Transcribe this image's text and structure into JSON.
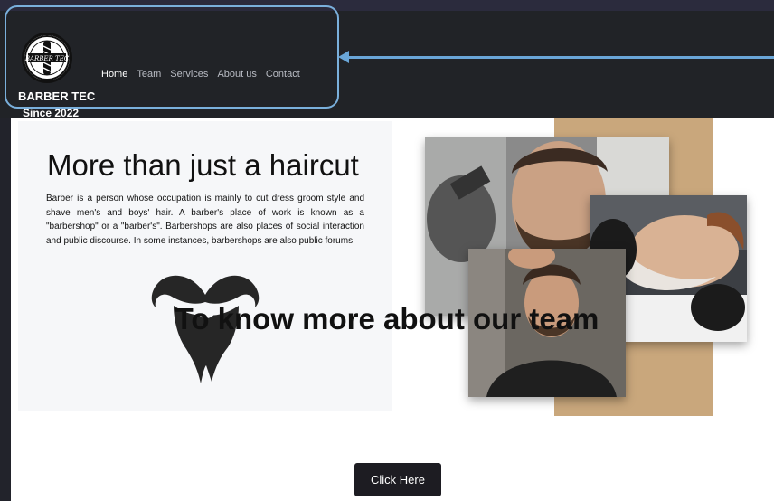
{
  "brand": {
    "logo_text": "BARBER TEC",
    "name": "BARBER TEC",
    "since": "Since 2022"
  },
  "nav": {
    "items": [
      "Home",
      "Team",
      "Services",
      "About us",
      "Contact"
    ],
    "active": "Home"
  },
  "hero": {
    "title": "More than just a haircut",
    "text": "Barber is a person whose occupation is mainly to cut dress groom style and shave men's and boys' hair. A barber's place of work is known as a \"barbershop\" or a \"barber's\". Barbershops are also places of social interaction and public discourse. In some instances, barbershops are also public forums",
    "decor_icon": "beard-mustache-icon"
  },
  "gallery": {
    "photos": [
      "barber-trimming-beard-photo",
      "customer-portrait-photo",
      "straight-razor-shave-photo"
    ]
  },
  "team": {
    "title": "To know more about our team",
    "button_label": "Click Here"
  },
  "colors": {
    "navbar": "#212327",
    "annotation": "#6aa6d8",
    "accent_tan": "#c9a77c",
    "button": "#1d1c22"
  }
}
